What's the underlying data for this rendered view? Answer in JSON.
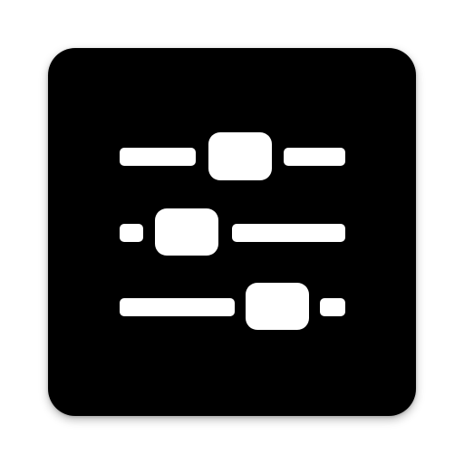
{
  "icon": {
    "name": "equalizer-sliders-icon",
    "background_color": "#000000",
    "glyph_color": "#ffffff"
  },
  "sliders": [
    {
      "name": "slider-top",
      "level": 0.55
    },
    {
      "name": "slider-middle",
      "level": 0.21
    },
    {
      "name": "slider-bottom",
      "level": 0.71
    }
  ]
}
